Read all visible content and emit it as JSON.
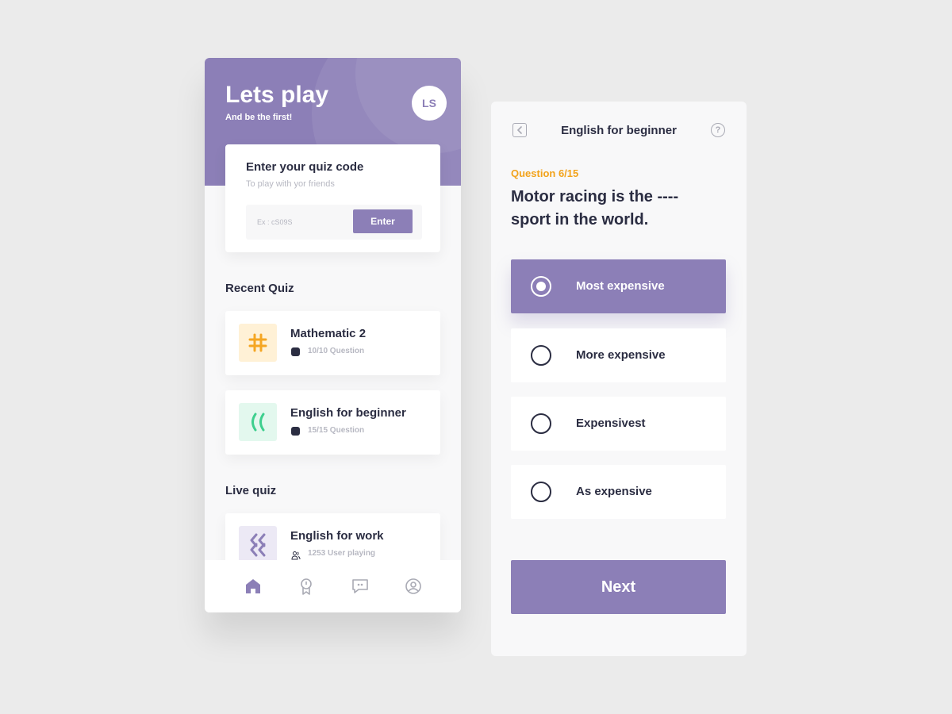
{
  "left": {
    "hero": {
      "title": "Lets play",
      "subtitle": "And be the first!",
      "avatar": "LS"
    },
    "code_card": {
      "title": "Enter your quiz code",
      "subtitle": "To play with yor friends",
      "input_placeholder": "Ex : cS09S",
      "button": "Enter"
    },
    "recent_label": "Recent Quiz",
    "recent": [
      {
        "title": "Mathematic 2",
        "meta": "10/10 Question",
        "icon": "hashtag-icon",
        "icon_color": "#f5a623",
        "icon_bg": "#fff1d6"
      },
      {
        "title": "English for beginner",
        "meta": "15/15 Question",
        "icon": "quote-icon",
        "icon_color": "#3ecf8e",
        "icon_bg": "#e3f8ee"
      }
    ],
    "live_label": "Live quiz",
    "live": [
      {
        "title": "English for work",
        "meta": "1253 User playing",
        "icon": "double-chevron-icon",
        "icon_color": "#8c7fb7",
        "icon_bg": "#ece9f5"
      }
    ],
    "tabs": [
      "home-icon",
      "award-icon",
      "chat-icon",
      "profile-icon"
    ]
  },
  "right": {
    "header_title": "English for beginner",
    "help": "?",
    "question_num": "Question 6/15",
    "question_text": "Motor racing is the ---- sport in the world.",
    "options": [
      {
        "label": "Most expensive",
        "selected": true
      },
      {
        "label": "More expensive",
        "selected": false
      },
      {
        "label": "Expensivest",
        "selected": false
      },
      {
        "label": "As expensive",
        "selected": false
      }
    ],
    "next": "Next"
  },
  "colors": {
    "accent": "#8c7fb7",
    "orange": "#f2a31b",
    "text": "#2b2d42"
  }
}
